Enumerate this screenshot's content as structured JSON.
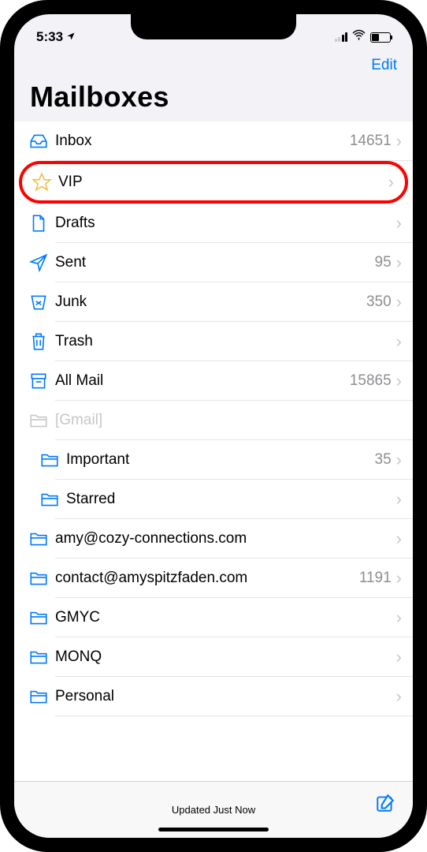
{
  "status": {
    "time": "5:33",
    "battery_pct": 40
  },
  "nav": {
    "edit_label": "Edit"
  },
  "title": "Mailboxes",
  "mailboxes": [
    {
      "id": "inbox",
      "icon": "inbox",
      "label": "Inbox",
      "count": "14651",
      "highlighted": false,
      "indented": false,
      "disabled": false
    },
    {
      "id": "vip",
      "icon": "star",
      "label": "VIP",
      "count": "",
      "highlighted": true,
      "indented": false,
      "disabled": false
    },
    {
      "id": "drafts",
      "icon": "document",
      "label": "Drafts",
      "count": "",
      "highlighted": false,
      "indented": false,
      "disabled": false
    },
    {
      "id": "sent",
      "icon": "paperplane",
      "label": "Sent",
      "count": "95",
      "highlighted": false,
      "indented": false,
      "disabled": false
    },
    {
      "id": "junk",
      "icon": "junk",
      "label": "Junk",
      "count": "350",
      "highlighted": false,
      "indented": false,
      "disabled": false
    },
    {
      "id": "trash",
      "icon": "trash",
      "label": "Trash",
      "count": "",
      "highlighted": false,
      "indented": false,
      "disabled": false
    },
    {
      "id": "allmail",
      "icon": "archive",
      "label": "All Mail",
      "count": "15865",
      "highlighted": false,
      "indented": false,
      "disabled": false
    },
    {
      "id": "gmail",
      "icon": "folder-gray",
      "label": "[Gmail]",
      "count": "",
      "highlighted": false,
      "indented": false,
      "disabled": true
    },
    {
      "id": "important",
      "icon": "folder",
      "label": "Important",
      "count": "35",
      "highlighted": false,
      "indented": true,
      "disabled": false
    },
    {
      "id": "starred",
      "icon": "folder",
      "label": "Starred",
      "count": "",
      "highlighted": false,
      "indented": true,
      "disabled": false
    },
    {
      "id": "amy",
      "icon": "folder",
      "label": "amy@cozy-connections.com",
      "count": "",
      "highlighted": false,
      "indented": false,
      "disabled": false
    },
    {
      "id": "contact",
      "icon": "folder",
      "label": "contact@amyspitzfaden.com",
      "count": "1191",
      "highlighted": false,
      "indented": false,
      "disabled": false
    },
    {
      "id": "gmyc",
      "icon": "folder",
      "label": "GMYC",
      "count": "",
      "highlighted": false,
      "indented": false,
      "disabled": false
    },
    {
      "id": "monq",
      "icon": "folder",
      "label": "MONQ",
      "count": "",
      "highlighted": false,
      "indented": false,
      "disabled": false
    },
    {
      "id": "personal",
      "icon": "folder",
      "label": "Personal",
      "count": "",
      "highlighted": false,
      "indented": false,
      "disabled": false
    }
  ],
  "bottom": {
    "status_text": "Updated Just Now"
  }
}
